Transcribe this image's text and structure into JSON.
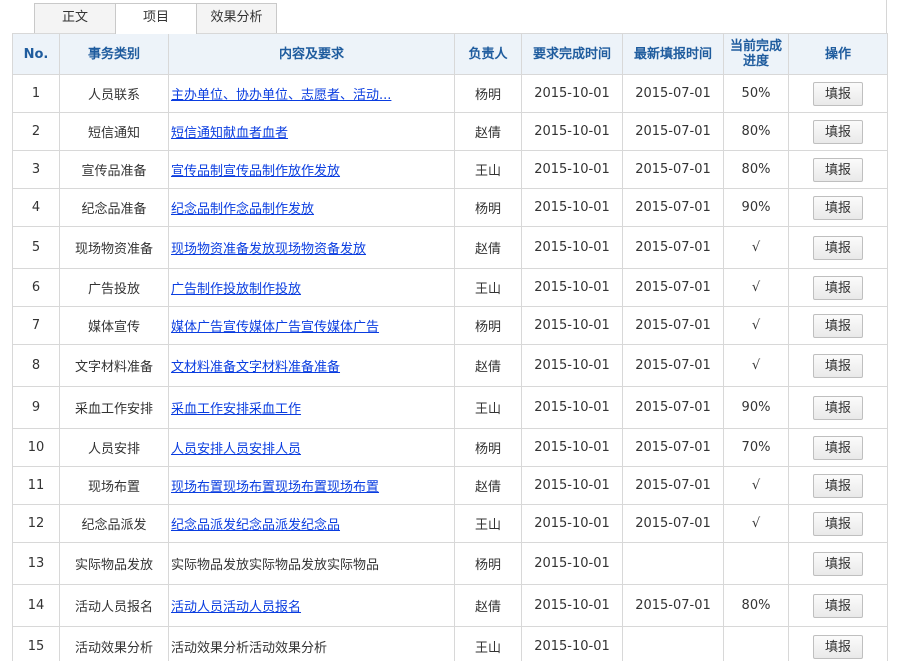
{
  "tabs": [
    {
      "label": "正文",
      "active": false
    },
    {
      "label": "项目",
      "active": true
    },
    {
      "label": "效果分析",
      "active": false
    }
  ],
  "columns": [
    "No.",
    "事务类别",
    "内容及要求",
    "负责人",
    "要求完成时间",
    "最新填报时间",
    "当前完成进度",
    "操作"
  ],
  "action_label": "填报",
  "rows": [
    {
      "no": "1",
      "category": "人员联系",
      "content": "主办单位、协办单位、志愿者、活动...",
      "linked": true,
      "owner": "杨明",
      "due": "2015-10-01",
      "reported": "2015-07-01",
      "progress": "50%"
    },
    {
      "no": "2",
      "category": "短信通知",
      "content": "短信通知献血者血者",
      "linked": true,
      "owner": "赵倩",
      "due": "2015-10-01",
      "reported": "2015-07-01",
      "progress": "80%"
    },
    {
      "no": "3",
      "category": "宣传品准备",
      "content": "宣传品制宣传品制作放作发放",
      "linked": true,
      "owner": "王山",
      "due": "2015-10-01",
      "reported": "2015-07-01",
      "progress": "80%"
    },
    {
      "no": "4",
      "category": "纪念品准备",
      "content": "纪念品制作念品制作发放",
      "linked": true,
      "owner": "杨明",
      "due": "2015-10-01",
      "reported": "2015-07-01",
      "progress": "90%"
    },
    {
      "no": "5",
      "category": "现场物资准备",
      "content": "现场物资准备发放现场物资备发放",
      "linked": true,
      "owner": "赵倩",
      "due": "2015-10-01",
      "reported": "2015-07-01",
      "progress": "√"
    },
    {
      "no": "6",
      "category": "广告投放",
      "content": "广告制作投放制作投放",
      "linked": true,
      "owner": "王山",
      "due": "2015-10-01",
      "reported": "2015-07-01",
      "progress": "√"
    },
    {
      "no": "7",
      "category": "媒体宣传",
      "content": "媒体广告宣传媒体广告宣传媒体广告",
      "linked": true,
      "owner": "杨明",
      "due": "2015-10-01",
      "reported": "2015-07-01",
      "progress": "√"
    },
    {
      "no": "8",
      "category": "文字材料准备",
      "content": "文材料准备文字材料准备准备",
      "linked": true,
      "owner": "赵倩",
      "due": "2015-10-01",
      "reported": "2015-07-01",
      "progress": "√"
    },
    {
      "no": "9",
      "category": "采血工作安排",
      "content": "采血工作安排采血工作",
      "linked": true,
      "owner": "王山",
      "due": "2015-10-01",
      "reported": "2015-07-01",
      "progress": "90%"
    },
    {
      "no": "10",
      "category": "人员安排",
      "content": "人员安排人员安排人员",
      "linked": true,
      "owner": "杨明",
      "due": "2015-10-01",
      "reported": "2015-07-01",
      "progress": "70%"
    },
    {
      "no": "11",
      "category": "现场布置",
      "content": "现场布置现场布置现场布置现场布置",
      "linked": true,
      "owner": "赵倩",
      "due": "2015-10-01",
      "reported": "2015-07-01",
      "progress": "√"
    },
    {
      "no": "12",
      "category": "纪念品派发",
      "content": "纪念品派发纪念品派发纪念品",
      "linked": true,
      "owner": "王山",
      "due": "2015-10-01",
      "reported": "2015-07-01",
      "progress": "√"
    },
    {
      "no": "13",
      "category": "实际物品发放",
      "content": "实际物品发放实际物品发放实际物品",
      "linked": false,
      "owner": "杨明",
      "due": "2015-10-01",
      "reported": "",
      "progress": ""
    },
    {
      "no": "14",
      "category": "活动人员报名",
      "content": "活动人员活动人员报名",
      "linked": true,
      "owner": "赵倩",
      "due": "2015-10-01",
      "reported": "2015-07-01",
      "progress": "80%"
    },
    {
      "no": "15",
      "category": "活动效果分析",
      "content": "活动效果分析活动效果分析",
      "linked": false,
      "owner": "王山",
      "due": "2015-10-01",
      "reported": "",
      "progress": ""
    }
  ]
}
